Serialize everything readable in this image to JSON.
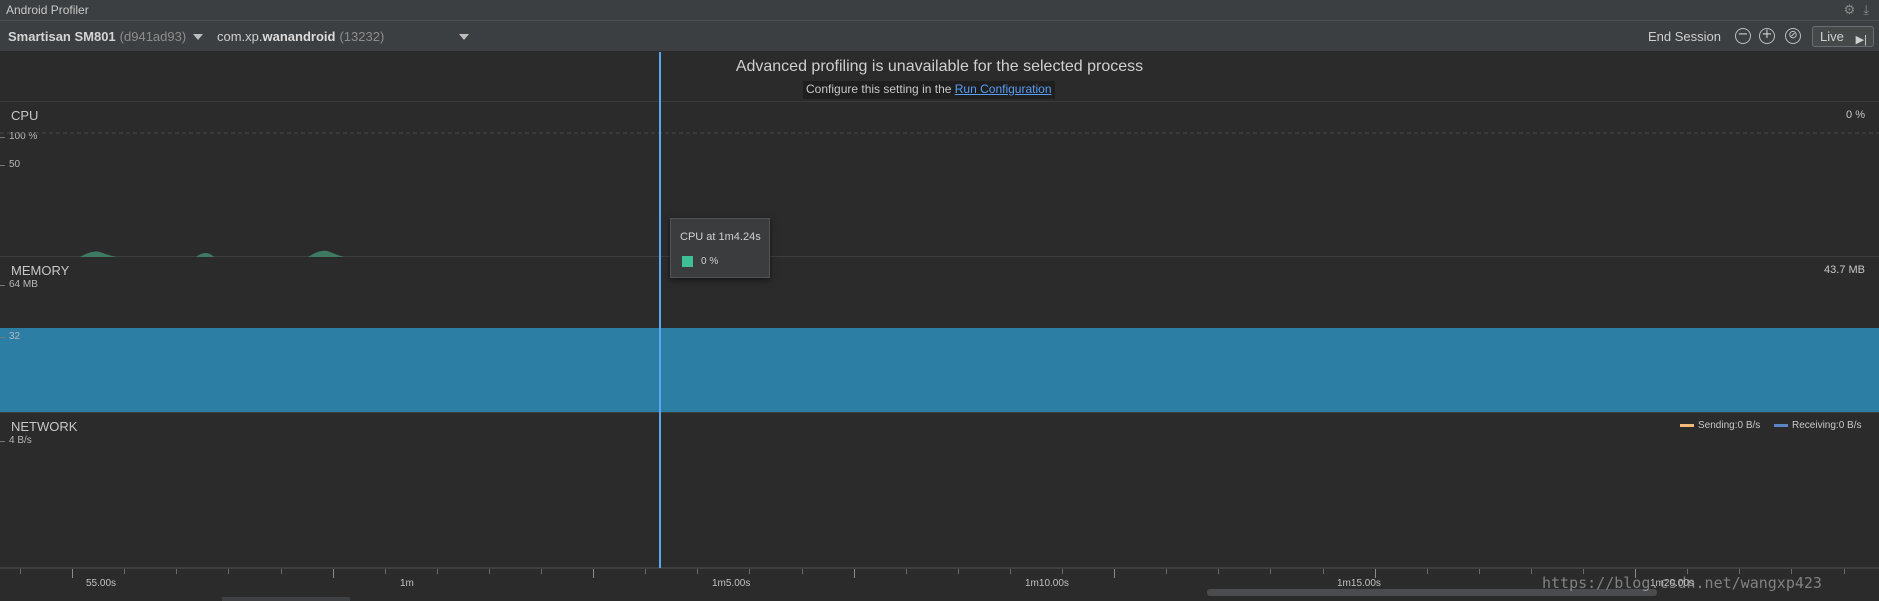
{
  "window": {
    "title": "Android Profiler"
  },
  "toolbar": {
    "device_name": "Smartisan SM801",
    "device_serial": "(d941ad93)",
    "process_prefix": "com.xp.",
    "process_bold": "wanandroid",
    "process_pid": "(13232)",
    "end_session": "End Session",
    "zoom_out": "−",
    "zoom_in": "+",
    "reset_zoom": "⊘",
    "live": "Live",
    "live_icon": "▶|"
  },
  "banner": {
    "headline": "Advanced profiling is unavailable for the selected process",
    "configure_text": "Configure this setting in the",
    "configure_link": "Run Configuration"
  },
  "cpu": {
    "label": "CPU",
    "current_value": "0 %",
    "y_max_label": "100 %",
    "y_mid_label": "50",
    "color": "#3e7a62"
  },
  "memory": {
    "label": "MEMORY",
    "current_value": "43.7 MB",
    "y_max_label": "64 MB",
    "y_mid_label": "32",
    "color": "#2d7ea5"
  },
  "network": {
    "label": "NETWORK",
    "y_max_label": "4 B/s",
    "sending_label": "Sending:",
    "sending_value": "0 B/s",
    "receiving_label": "Receiving:",
    "receiving_value": "0 B/s",
    "sending_color": "#f2ba7a",
    "receiving_color": "#5b86c5"
  },
  "tooltip": {
    "title": "CPU at 1m4.24s",
    "value": "0 %",
    "color": "#3fbf95"
  },
  "time_axis": {
    "labels": [
      "55.00s",
      "1m",
      "1m5.00s",
      "1m10.00s",
      "1m15.00s",
      "1m20.00s"
    ]
  },
  "watermark": "https://blog.csdn.net/wangxp423"
}
